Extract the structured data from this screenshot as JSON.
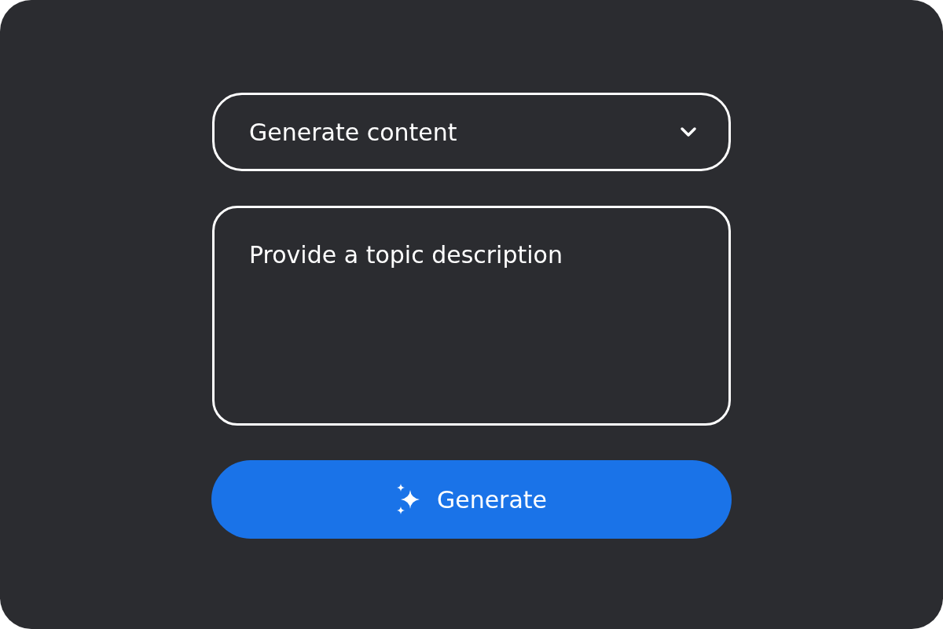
{
  "select": {
    "value": "Generate content"
  },
  "topic": {
    "placeholder": "Provide a topic description"
  },
  "button": {
    "label": "Generate"
  }
}
